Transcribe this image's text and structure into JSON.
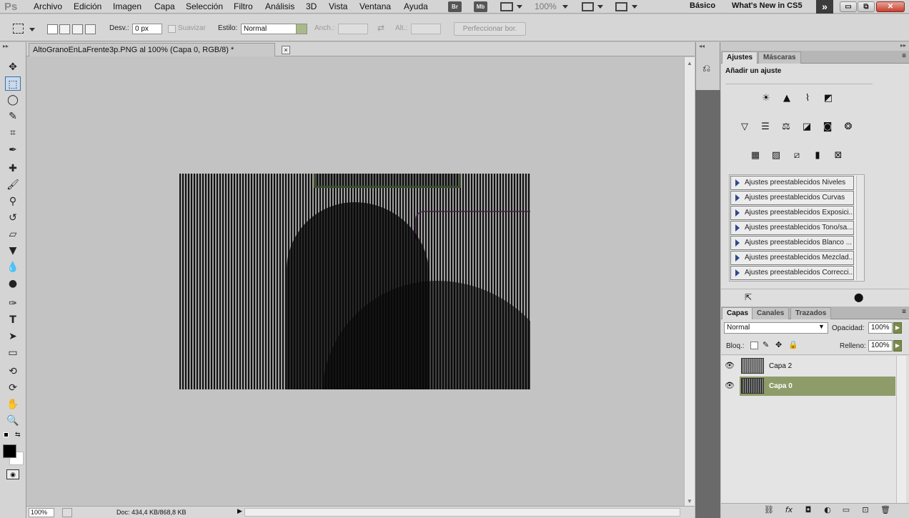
{
  "app": {
    "logo": "Ps"
  },
  "menu": [
    "Archivo",
    "Edición",
    "Imagen",
    "Capa",
    "Selección",
    "Filtro",
    "Análisis",
    "3D",
    "Vista",
    "Ventana",
    "Ayuda"
  ],
  "appbar": {
    "bridge": "Br",
    "minibridge": "Mb",
    "zoom": "100%"
  },
  "workspace": {
    "basic": "Básico",
    "whatsnew": "What's New in CS5",
    "more": "»"
  },
  "window_buttons": {
    "minimize": "▭",
    "restore": "⧉",
    "close": "✕"
  },
  "options": {
    "feather_label": "Desv.:",
    "feather_value": "0 px",
    "antialias_label": "Suavizar",
    "style_label": "Estilo:",
    "style_value": "Normal",
    "width_label": "Anch.:",
    "height_label": "Alt.:",
    "refine_label": "Perfeccionar bor."
  },
  "document": {
    "tab_title": "AltoGranoEnLaFrente3p.PNG al 100% (Capa 0, RGB/8) *",
    "close": "×",
    "zoom": "100%",
    "doc_info": "Doc: 434,4 KB/868,8 KB"
  },
  "colors": {
    "accent_selected_layer": "#8e9c6a",
    "foreground": "#000000",
    "background": "#ffffff"
  },
  "adjustments": {
    "tabs": [
      "Ajustes",
      "Máscaras"
    ],
    "heading": "Añadir un ajuste",
    "presets": [
      "Ajustes preestablecidos Niveles",
      "Ajustes preestablecidos Curvas",
      "Ajustes preestablecidos Exposici...",
      "Ajustes preestablecidos Tono/sa...",
      "Ajustes preestablecidos Blanco ...",
      "Ajustes preestablecidos Mezclad...",
      "Ajustes preestablecidos Correcci..."
    ]
  },
  "layers": {
    "tabs": [
      "Capas",
      "Canales",
      "Trazados"
    ],
    "blend_mode": "Normal",
    "opacity_label": "Opacidad:",
    "opacity_value": "100%",
    "lock_label": "Bloq.:",
    "fill_label": "Relleno:",
    "fill_value": "100%",
    "items": [
      {
        "name": "Capa 2",
        "selected": false
      },
      {
        "name": "Capa 0",
        "selected": true
      }
    ]
  }
}
